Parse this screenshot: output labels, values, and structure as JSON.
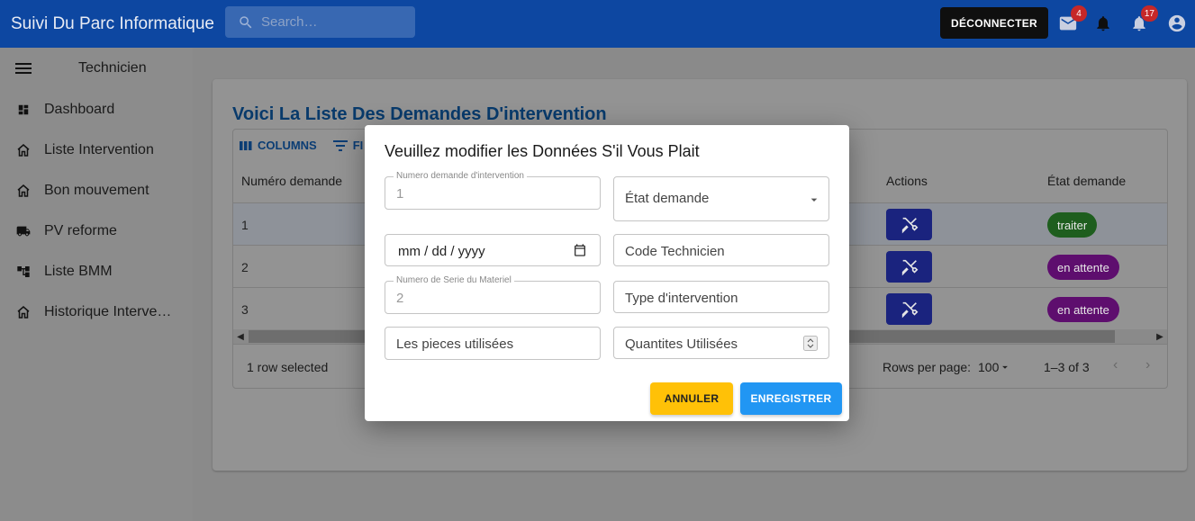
{
  "appbar": {
    "title": "Suivi Du Parc Informatique",
    "search_placeholder": "Search…",
    "logout_label": "DÉCONNECTER",
    "mail_badge": "4",
    "notif_badge": "17"
  },
  "sidebar": {
    "title": "Technicien",
    "items": [
      {
        "label": "Dashboard",
        "icon": "dashboard-icon"
      },
      {
        "label": "Liste Intervention",
        "icon": "home-icon"
      },
      {
        "label": "Bon mouvement",
        "icon": "home-icon"
      },
      {
        "label": "PV reforme",
        "icon": "truck-icon"
      },
      {
        "label": "Liste BMM",
        "icon": "account-tree-icon"
      },
      {
        "label": "Historique Intervention",
        "icon": "home-icon"
      }
    ]
  },
  "main": {
    "heading": "Voici La Liste Des Demandes D'intervention",
    "toolbar": {
      "columns": "COLUMNS",
      "filters": "FI"
    },
    "columns": {
      "numero": "Numéro demande",
      "actions": "Actions",
      "etat": "État demande"
    },
    "rows": [
      {
        "numero": "1",
        "etat": "traiter",
        "status_color": "#1e5e1e"
      },
      {
        "numero": "2",
        "etat": "en attente",
        "status_color": "#5e0e6e"
      },
      {
        "numero": "3",
        "etat": "en attente",
        "status_color": "#5e0e6e"
      }
    ],
    "footer": {
      "selected": "1 row selected",
      "rows_per_page_label": "Rows per page:",
      "rows_per_page_value": "100",
      "range": "1–3 of 3"
    }
  },
  "dialog": {
    "title": "Veuillez modifier les Données S'il Vous Plait",
    "fields": {
      "numero_label": "Numero demande d'intervention",
      "numero_value": "1",
      "etat_placeholder": "État demande",
      "date_placeholder": "mm / dd / yyyy",
      "code_tech_placeholder": "Code Technicien",
      "serie_label": "Numero de Serie du Materiel",
      "serie_value": "2",
      "type_placeholder": "Type d'intervention",
      "pieces_placeholder": "Les pieces utilisées",
      "quantites_placeholder": "Quantites Utilisées"
    },
    "cancel_label": "ANNULER",
    "save_label": "ENREGISTRER"
  },
  "colors": {
    "appbar": "#0d47a1",
    "heading": "#083a6b",
    "cancel_button": "#ffc107",
    "save_button": "#2196f3",
    "action_button": "#1a237e"
  }
}
